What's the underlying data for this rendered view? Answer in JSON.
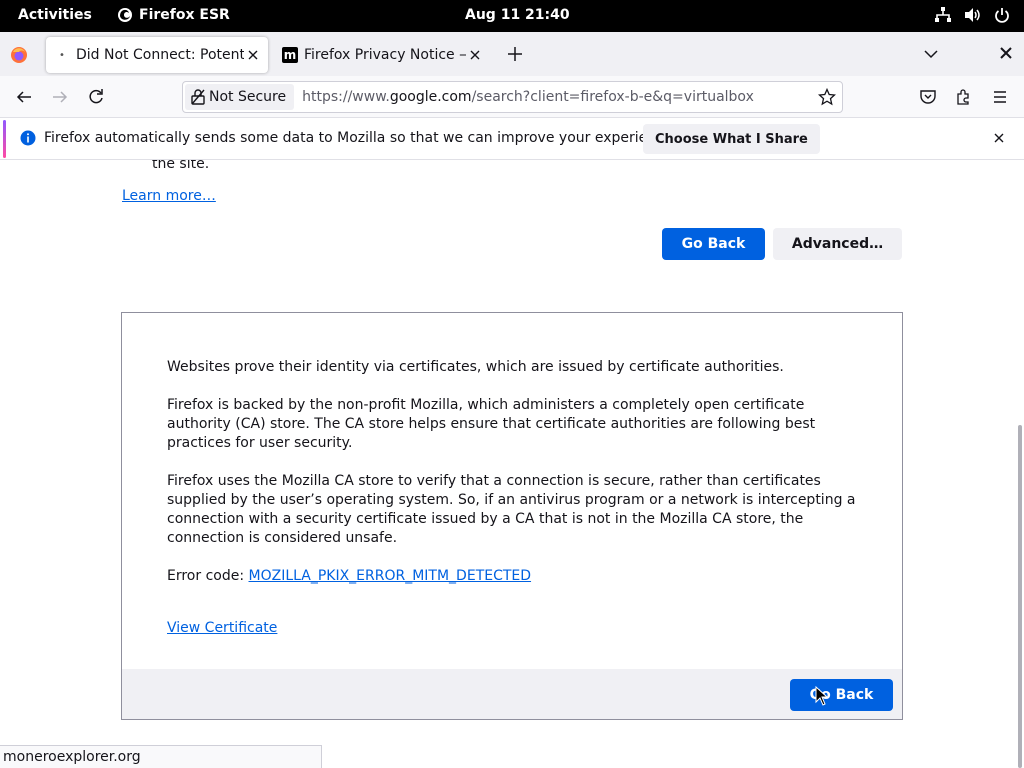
{
  "gnome": {
    "activities": "Activities",
    "app_name": "Firefox ESR",
    "clock": "Aug 11  21:40"
  },
  "tabs": [
    {
      "title": "Did Not Connect: Potential Security Issue",
      "active": true
    },
    {
      "title": "Firefox Privacy Notice — Mozilla",
      "active": false
    }
  ],
  "navbar": {
    "security_label": "Not Secure",
    "url_prefix": "https://www.",
    "url_domain": "google.com",
    "url_rest": "/search?client=firefox-b-e&q=virtualbox"
  },
  "notification": {
    "message": "Firefox automatically sends some data to Mozilla so that we can improve your experience.",
    "action_label": "Choose What I Share"
  },
  "page": {
    "fragment_text": "the site.",
    "learn_more": "Learn more…",
    "go_back": "Go Back",
    "advanced": "Advanced…",
    "panel": {
      "p1": "Websites prove their identity via certificates, which are issued by certificate authorities.",
      "p2": "Firefox is backed by the non-profit Mozilla, which administers a completely open certificate authority (CA) store. The CA store helps ensure that certificate authorities are following best practices for user security.",
      "p3": "Firefox uses the Mozilla CA store to verify that a connection is secure, rather than certificates supplied by the user’s operating system. So, if an antivirus program or a network is intercepting a connection with a security certificate issued by a CA that is not in the Mozilla CA store, the connection is considered unsafe.",
      "error_label": "Error code: ",
      "error_code": "MOZILLA_PKIX_ERROR_MITM_DETECTED",
      "view_certificate": "View Certificate",
      "go_back": "Go Back"
    }
  },
  "statusbar": {
    "text": "moneroexplorer.org"
  },
  "colors": {
    "accent_blue": "#0061e0",
    "toolbar": "#f9f9fb",
    "tabstrip": "#f0f0f4"
  }
}
